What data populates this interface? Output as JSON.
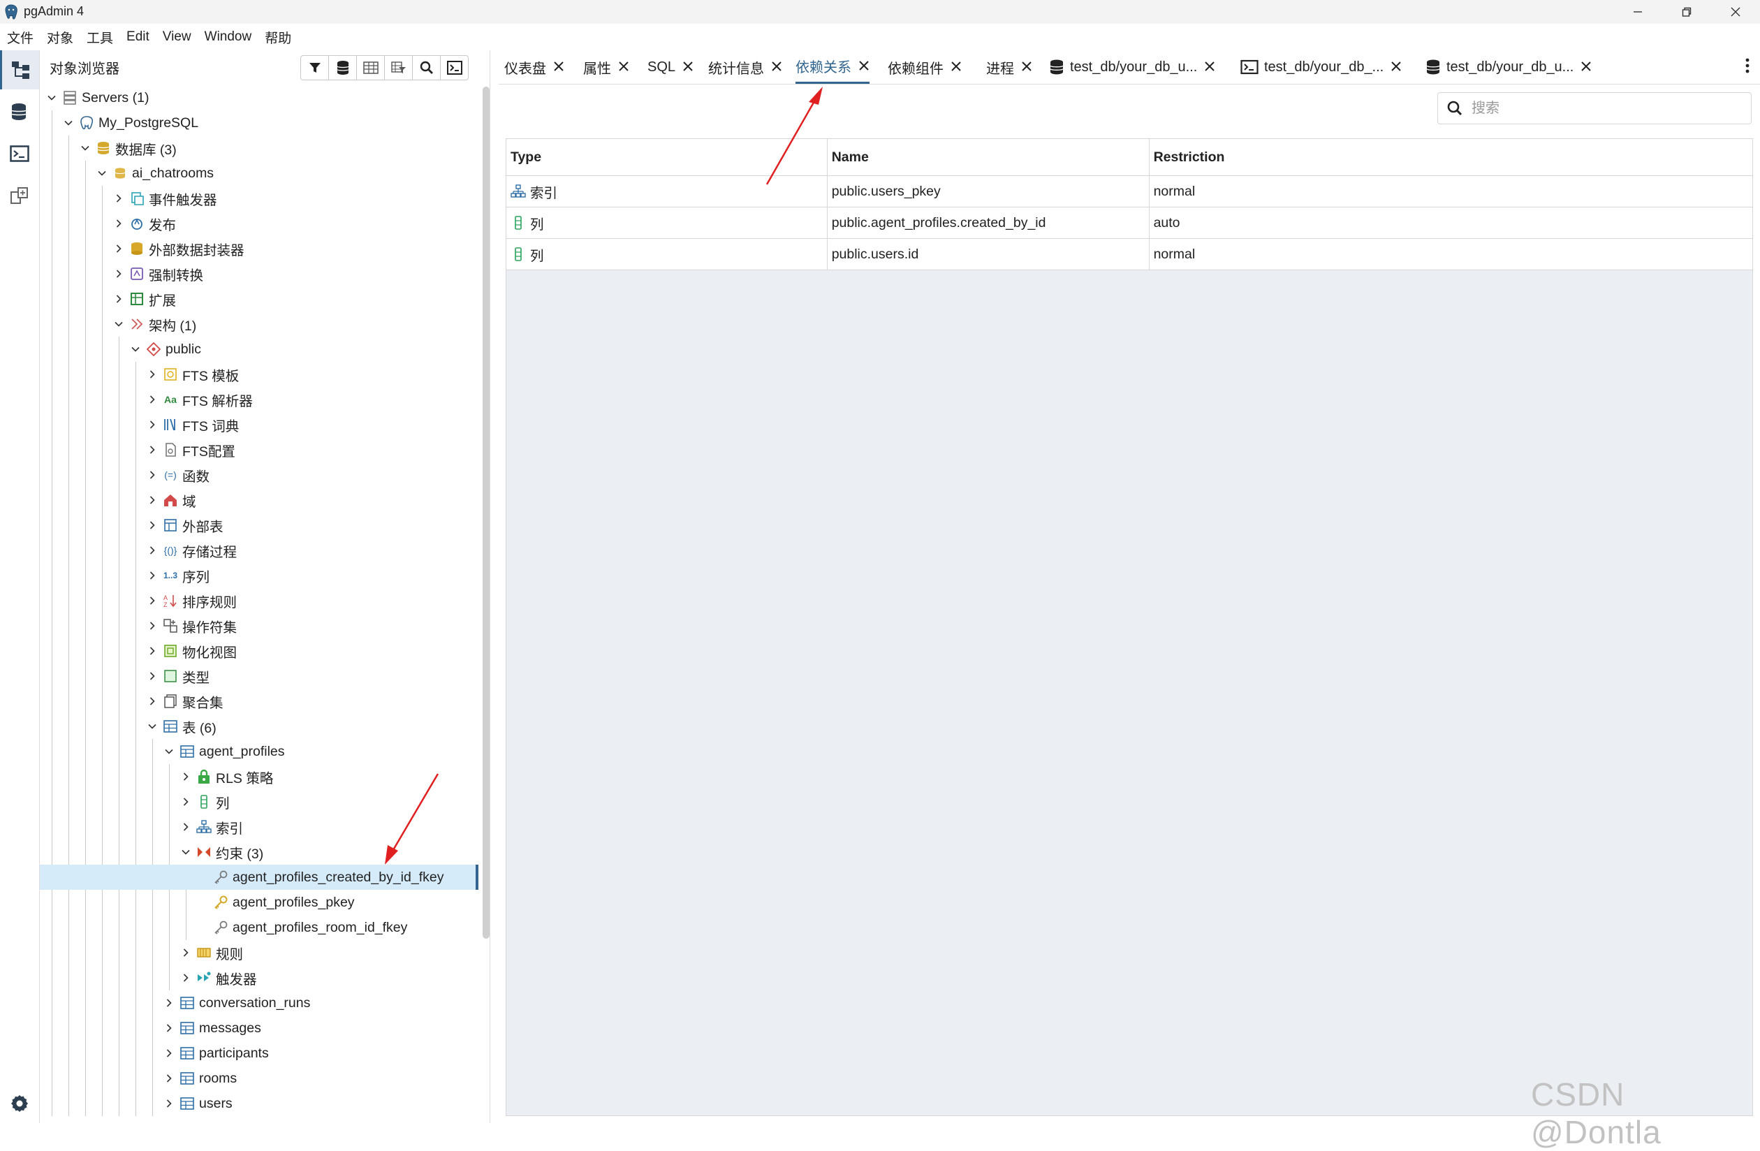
{
  "window": {
    "title": "pgAdmin 4",
    "minimize_icon": "minimize-icon",
    "restore_icon": "restore-icon",
    "close_icon": "close-icon"
  },
  "menubar": [
    "文件",
    "对象",
    "工具",
    "Edit",
    "View",
    "Window",
    "帮助"
  ],
  "activitybar": [
    "object-explorer-icon",
    "query-tool-icon",
    "psql-icon",
    "schema-diff-icon",
    "settings-icon"
  ],
  "browser": {
    "title": "对象浏览器",
    "toolbar": [
      "filter-icon",
      "database-icon",
      "table-view-icon",
      "filtered-rows-icon",
      "search-icon",
      "terminal-icon"
    ],
    "tree": [
      {
        "level": 0,
        "expanded": true,
        "icon": "servers-icon",
        "label": "Servers (1)"
      },
      {
        "level": 1,
        "expanded": true,
        "icon": "postgres-icon",
        "label": "My_PostgreSQL"
      },
      {
        "level": 2,
        "expanded": true,
        "icon": "databases-icon",
        "label": "数据库 (3)"
      },
      {
        "level": 3,
        "expanded": true,
        "icon": "database-icon",
        "label": "ai_chatrooms"
      },
      {
        "level": 4,
        "expanded": false,
        "icon": "event-trigger-icon",
        "label": "事件触发器"
      },
      {
        "level": 4,
        "expanded": false,
        "icon": "publication-icon",
        "label": "发布"
      },
      {
        "level": 4,
        "expanded": false,
        "icon": "fdw-icon",
        "label": "外部数据封装器"
      },
      {
        "level": 4,
        "expanded": false,
        "icon": "cast-icon",
        "label": "强制转换"
      },
      {
        "level": 4,
        "expanded": false,
        "icon": "extension-icon",
        "label": "扩展"
      },
      {
        "level": 4,
        "expanded": true,
        "icon": "schemas-icon",
        "label": "架构 (1)"
      },
      {
        "level": 5,
        "expanded": true,
        "icon": "schema-icon",
        "label": "public"
      },
      {
        "level": 6,
        "expanded": false,
        "icon": "fts-template-icon",
        "label": "FTS 模板"
      },
      {
        "level": 6,
        "expanded": false,
        "icon": "fts-parser-icon",
        "label": "FTS 解析器"
      },
      {
        "level": 6,
        "expanded": false,
        "icon": "fts-dictionary-icon",
        "label": "FTS 词典"
      },
      {
        "level": 6,
        "expanded": false,
        "icon": "fts-config-icon",
        "label": "FTS配置"
      },
      {
        "level": 6,
        "expanded": false,
        "icon": "function-icon",
        "label": "函数"
      },
      {
        "level": 6,
        "expanded": false,
        "icon": "domain-icon",
        "label": "域"
      },
      {
        "level": 6,
        "expanded": false,
        "icon": "foreign-table-icon",
        "label": "外部表"
      },
      {
        "level": 6,
        "expanded": false,
        "icon": "procedure-icon",
        "label": "存储过程"
      },
      {
        "level": 6,
        "expanded": false,
        "icon": "sequence-icon",
        "label": "序列"
      },
      {
        "level": 6,
        "expanded": false,
        "icon": "collation-icon",
        "label": "排序规则"
      },
      {
        "level": 6,
        "expanded": false,
        "icon": "operator-icon",
        "label": "操作符集"
      },
      {
        "level": 6,
        "expanded": false,
        "icon": "mview-icon",
        "label": "物化视图"
      },
      {
        "level": 6,
        "expanded": false,
        "icon": "type-icon",
        "label": "类型"
      },
      {
        "level": 6,
        "expanded": false,
        "icon": "aggregate-icon",
        "label": "聚合集"
      },
      {
        "level": 6,
        "expanded": true,
        "icon": "tables-icon",
        "label": "表 (6)"
      },
      {
        "level": 7,
        "expanded": true,
        "icon": "table-icon",
        "label": "agent_profiles"
      },
      {
        "level": 8,
        "expanded": false,
        "icon": "rls-policy-icon",
        "label": "RLS 策略"
      },
      {
        "level": 8,
        "expanded": false,
        "icon": "columns-icon",
        "label": "列"
      },
      {
        "level": 8,
        "expanded": false,
        "icon": "index-icon",
        "label": "索引"
      },
      {
        "level": 8,
        "expanded": true,
        "icon": "constraints-icon",
        "label": "约束 (3)"
      },
      {
        "level": 9,
        "leaf": true,
        "selected": true,
        "icon": "foreign-key-icon",
        "label": "agent_profiles_created_by_id_fkey"
      },
      {
        "level": 9,
        "leaf": true,
        "icon": "primary-key-icon",
        "label": "agent_profiles_pkey"
      },
      {
        "level": 9,
        "leaf": true,
        "icon": "foreign-key-icon",
        "label": "agent_profiles_room_id_fkey"
      },
      {
        "level": 8,
        "expanded": false,
        "icon": "rules-icon",
        "label": "规则"
      },
      {
        "level": 8,
        "expanded": false,
        "icon": "trigger-icon",
        "label": "触发器"
      },
      {
        "level": 7,
        "expanded": false,
        "icon": "table-icon",
        "label": "conversation_runs"
      },
      {
        "level": 7,
        "expanded": false,
        "icon": "table-icon",
        "label": "messages"
      },
      {
        "level": 7,
        "expanded": false,
        "icon": "table-icon",
        "label": "participants"
      },
      {
        "level": 7,
        "expanded": false,
        "icon": "table-icon",
        "label": "rooms"
      },
      {
        "level": 7,
        "expanded": false,
        "icon": "table-icon",
        "label": "users"
      }
    ]
  },
  "tabs": [
    {
      "label": "仪表盘",
      "active": false
    },
    {
      "label": "属性",
      "active": false
    },
    {
      "label": "SQL",
      "active": false
    },
    {
      "label": "统计信息",
      "active": false
    },
    {
      "label": "依赖关系",
      "active": true
    },
    {
      "label": "依赖组件",
      "active": false
    },
    {
      "label": "进程",
      "active": false
    },
    {
      "label": "test_db/your_db_u...",
      "active": false,
      "icon": "database-icon"
    },
    {
      "label": "test_db/your_db_...",
      "active": false,
      "icon": "terminal-icon"
    },
    {
      "label": "test_db/your_db_u...",
      "active": false,
      "icon": "database-icon"
    }
  ],
  "search": {
    "placeholder": "搜索",
    "value": ""
  },
  "dependencies": {
    "columns": [
      "Type",
      "Name",
      "Restriction"
    ],
    "rows": [
      {
        "type_icon": "index-icon",
        "type": "索引",
        "name": "public.users_pkey",
        "restriction": "normal"
      },
      {
        "type_icon": "column-icon",
        "type": "列",
        "name": "public.agent_profiles.created_by_id",
        "restriction": "auto"
      },
      {
        "type_icon": "column-icon",
        "type": "列",
        "name": "public.users.id",
        "restriction": "normal"
      }
    ]
  },
  "watermark": "CSDN @Dontla",
  "colors": {
    "accent": "#326690",
    "selected_row": "#d6ebfa",
    "annotation_arrow": "#e02020",
    "grid_bg": "#ebeef3"
  }
}
